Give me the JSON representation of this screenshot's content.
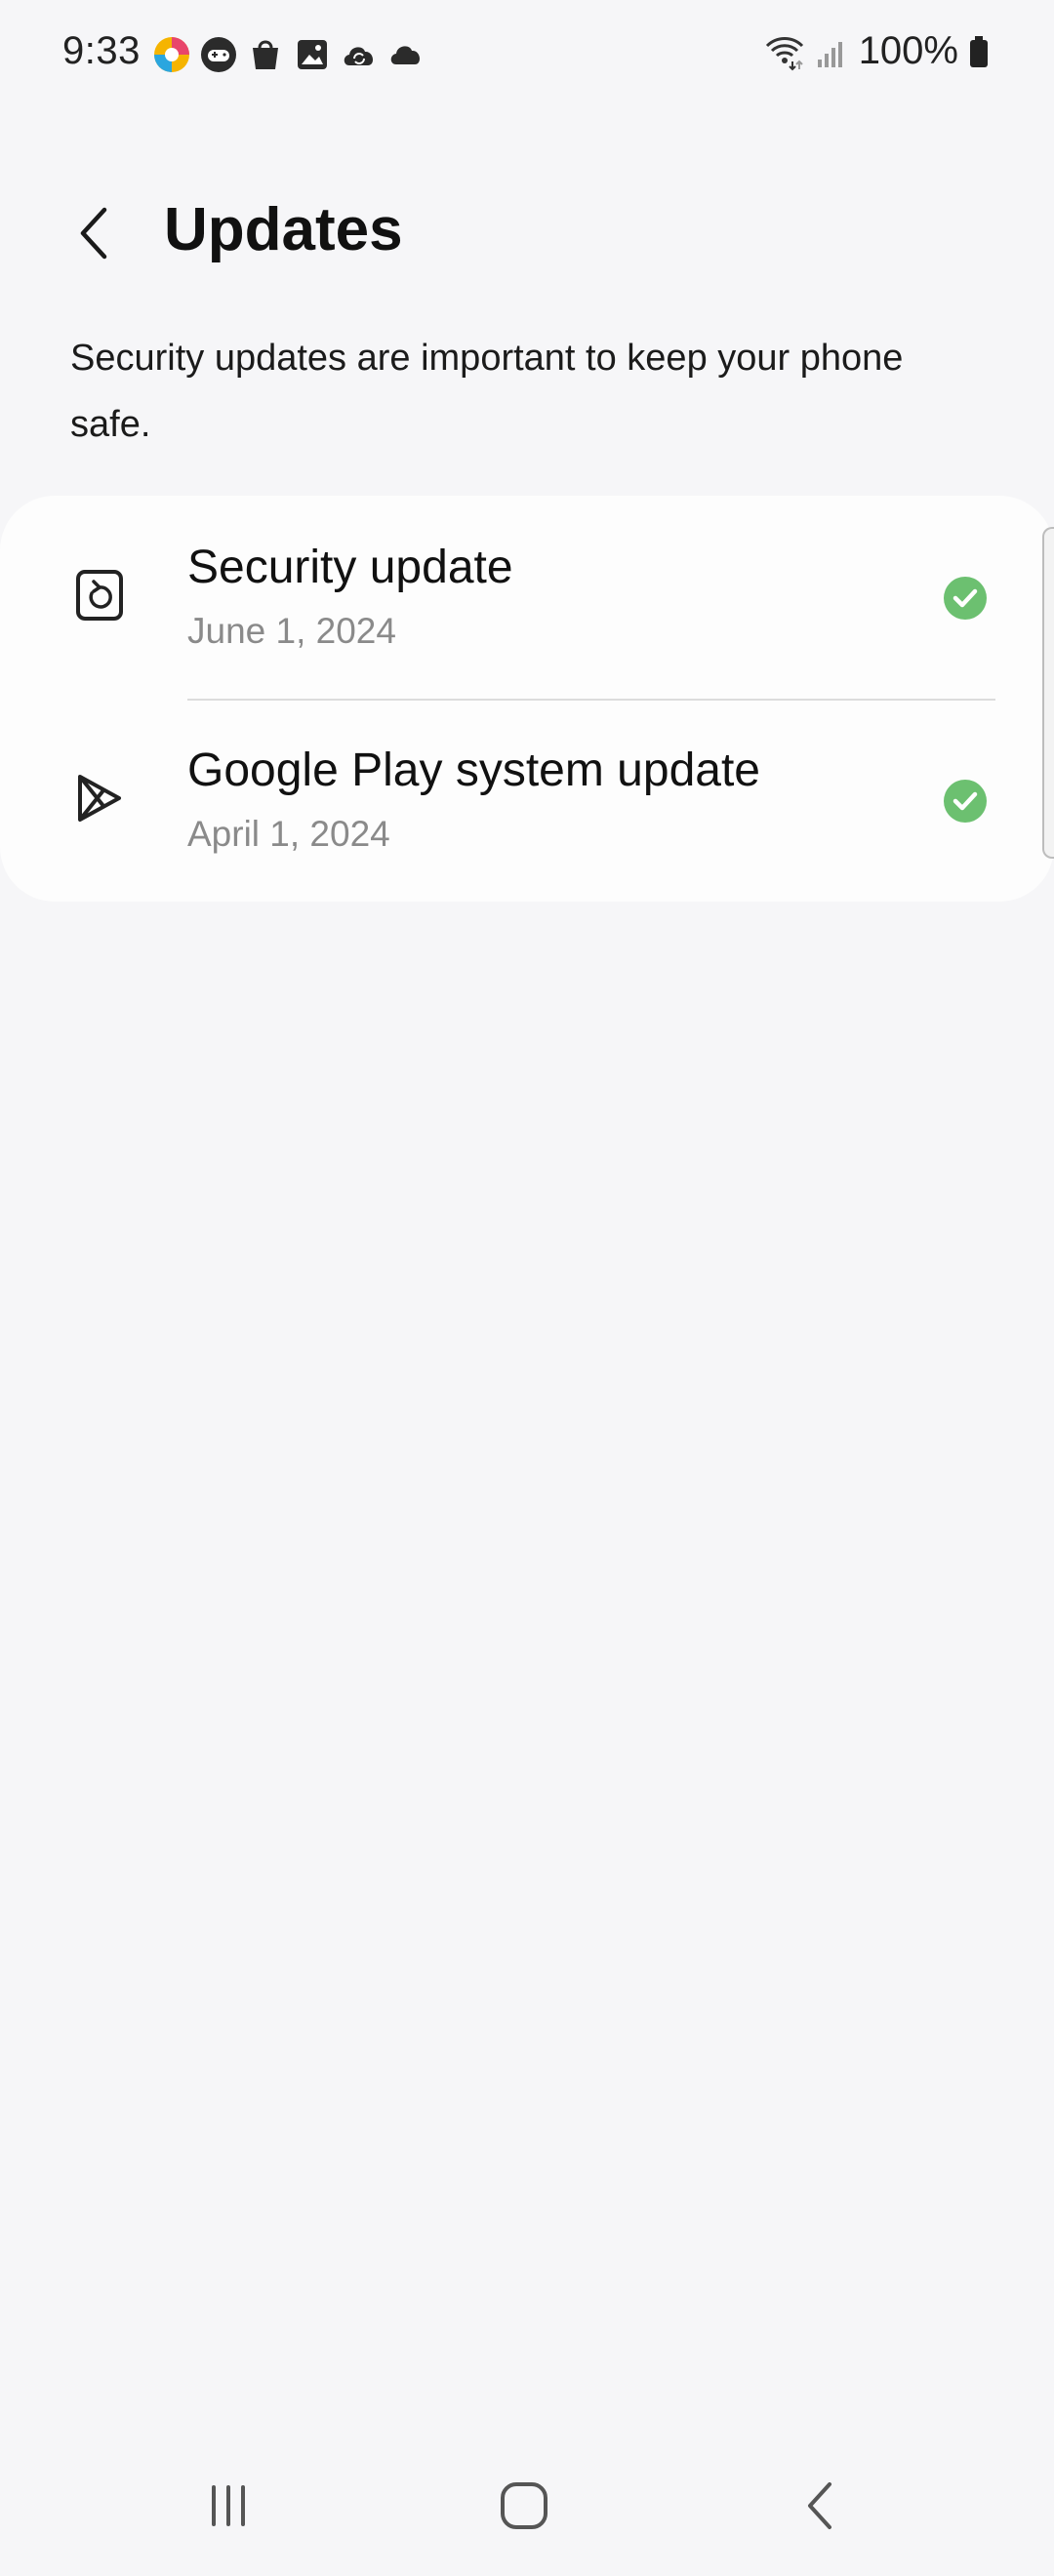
{
  "status_bar": {
    "time": "9:33",
    "battery_percent": "100%",
    "notification_icons": [
      "photos-app-icon",
      "game-launcher-icon",
      "galaxy-store-icon",
      "gallery-icon",
      "cloud-sync-icon",
      "cloud-icon"
    ],
    "system_icons": [
      "wifi-icon",
      "signal-icon",
      "battery-icon"
    ]
  },
  "header": {
    "title": "Updates",
    "back_icon": "chevron-left-icon"
  },
  "description": "Security updates are important to keep your phone safe.",
  "updates": [
    {
      "title": "Security update",
      "date": "June 1, 2024",
      "icon": "security-update-icon",
      "status_icon": "check-circle-icon"
    },
    {
      "title": "Google Play system update",
      "date": "April 1, 2024",
      "icon": "google-play-icon",
      "status_icon": "check-circle-icon"
    }
  ],
  "colors": {
    "background": "#f6f6f8",
    "card": "#fdfdfd",
    "check_green": "#6cc070",
    "secondary_text": "#8a8a8a"
  },
  "nav_bar": {
    "buttons": [
      "recents-icon",
      "home-icon",
      "back-icon"
    ]
  }
}
